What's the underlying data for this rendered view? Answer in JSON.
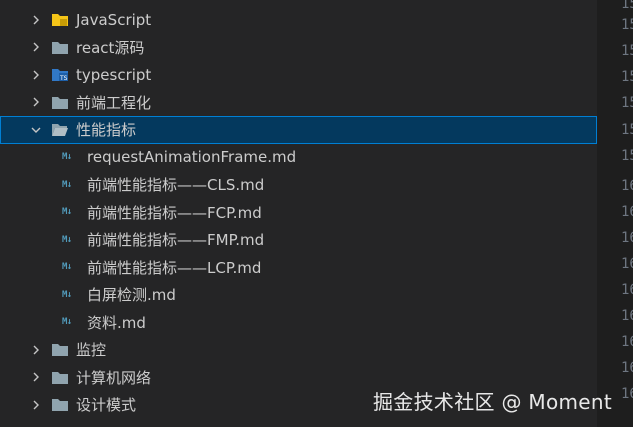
{
  "tree": {
    "folders_top": [
      {
        "label": "JavaScript",
        "icon": "js-folder-icon",
        "color": "#f5c518"
      },
      {
        "label": "react源码",
        "icon": "folder-icon",
        "color": "#90a4ae"
      },
      {
        "label": "typescript",
        "icon": "ts-folder-icon",
        "color": "#3178c6"
      },
      {
        "label": "前端工程化",
        "icon": "folder-icon",
        "color": "#90a4ae"
      }
    ],
    "open_folder": {
      "label": "性能指标",
      "icon": "folder-open-icon"
    },
    "files": [
      {
        "label": "requestAnimationFrame.md",
        "icon_text": "M↓"
      },
      {
        "label": "前端性能指标——CLS.md",
        "icon_text": "M↓"
      },
      {
        "label": "前端性能指标——FCP.md",
        "icon_text": "M↓"
      },
      {
        "label": "前端性能指标——FMP.md",
        "icon_text": "M↓"
      },
      {
        "label": "前端性能指标——LCP.md",
        "icon_text": "M↓"
      },
      {
        "label": "白屏检测.md",
        "icon_text": "M↓"
      },
      {
        "label": "资料.md",
        "icon_text": "M↓"
      }
    ],
    "folders_bottom": [
      {
        "label": "监控"
      },
      {
        "label": "计算机网络"
      },
      {
        "label": "设计模式"
      }
    ]
  },
  "gutter": [
    "15",
    "15",
    "15",
    "15",
    "15",
    "15",
    "15",
    "16",
    "16",
    "16",
    "16",
    "16",
    "16",
    "16",
    "16",
    "16"
  ],
  "watermark": "掘金技术社区 @ Moment",
  "colors": {
    "selection_bg": "#04395e",
    "selection_border": "#007fd4",
    "md_icon": "#519aba"
  }
}
